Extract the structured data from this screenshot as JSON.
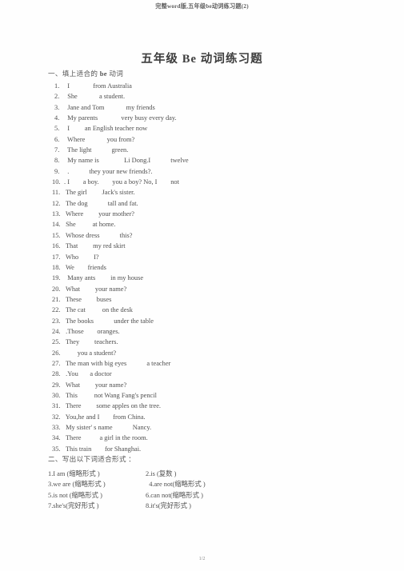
{
  "document": {
    "running_header": "完整word版,五年级be动词练习题(2)",
    "title": "五年级  Be  动词练习题",
    "footer": "1/2"
  },
  "section_one": {
    "heading_cn_prefix": "一、填上适合的  ",
    "heading_en": "be",
    "heading_cn_suffix": " 动词",
    "items": [
      {
        "num": "1.",
        "text": "  I              from Australia"
      },
      {
        "num": "2.",
        "text": "  She             a student."
      },
      {
        "num": "3.",
        "text": "  Jane and Tom             my friends"
      },
      {
        "num": "4.",
        "text": "  My parents              very busy every day."
      },
      {
        "num": "5.",
        "text": "  I         an English teacher now"
      },
      {
        "num": "6.",
        "text": "  Where             you from?"
      },
      {
        "num": "7.",
        "text": "  The light            green."
      },
      {
        "num": "8.",
        "text": "  My name is               Li Dong.I            twelve"
      },
      {
        "num": "9.",
        "text": "  .            they your new friends?."
      },
      {
        "num": "10.",
        "text": ". I        a boy.        you a boy? No, I        not"
      },
      {
        "num": "11.",
        "text": " The girl         Jack's sister."
      },
      {
        "num": "12.",
        "text": " The dog            tall and fat."
      },
      {
        "num": "13.",
        "text": " Where         your mother?"
      },
      {
        "num": "14.",
        "text": " She          at home."
      },
      {
        "num": "15.",
        "text": " Whose dress            this?"
      },
      {
        "num": "16.",
        "text": " That         my red skirt"
      },
      {
        "num": "17.",
        "text": " Who         I?"
      },
      {
        "num": "18.",
        "text": " We        friends"
      },
      {
        "num": "19.",
        "text": "  Many ants         in my house"
      },
      {
        "num": "20.",
        "text": " What         your name?"
      },
      {
        "num": "21.",
        "text": " These         buses"
      },
      {
        "num": "22.",
        "text": " The cat          on the desk"
      },
      {
        "num": "23.",
        "text": " The books            under the table"
      },
      {
        "num": "24.",
        "text": " .Those        oranges."
      },
      {
        "num": "25.",
        "text": " They         teachers."
      },
      {
        "num": "26.",
        "text": "        you a student?"
      },
      {
        "num": "27.",
        "text": " The man with big eyes            a teacher"
      },
      {
        "num": "28.",
        "text": " .You       a doctor"
      },
      {
        "num": "29.",
        "text": " What         your name?"
      },
      {
        "num": "30.",
        "text": " This          not Wang Fang's pencil"
      },
      {
        "num": "31.",
        "text": " There         some apples on the tree."
      },
      {
        "num": "32.",
        "text": " You,he and I        from China."
      },
      {
        "num": "33.",
        "text": " My sister' s name            Nancy."
      },
      {
        "num": "34.",
        "text": " There           a girl in the room."
      },
      {
        "num": "35.",
        "text": " This train        for Shanghai."
      }
    ]
  },
  "section_two": {
    "heading": "二、写出以下词适合形式 ：",
    "rows": [
      {
        "left": "1.I am (缩略形式 )",
        "right": "2.is (复数 )"
      },
      {
        "left": "3.we are (缩略形式 )",
        "right": "  4.are not(缩略形式 )"
      },
      {
        "left": "5.is not (缩略形式 )",
        "right": "6.can not(缩略形式 )"
      },
      {
        "left": "7.she's(完好形式 )",
        "right": "8.it's(完好形式 )"
      }
    ]
  }
}
